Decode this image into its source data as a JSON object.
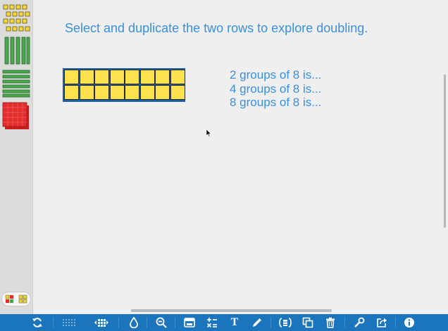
{
  "canvas": {
    "instruction": "Select and duplicate the two rows to explore doubling.",
    "prompts": [
      "2 groups of 8 is...",
      "4 groups of 8 is...",
      "8 groups of 8 is..."
    ],
    "blocks": {
      "rows": 2,
      "columns": 8,
      "fill_color": "#fde24d",
      "frame_color": "#1c5fa8"
    }
  },
  "sidebar": {
    "tools": [
      "units-tool",
      "tens-rods-tool",
      "hundreds-flats-tool",
      "thousands-cubes-tool"
    ]
  },
  "toolbar": {
    "text_tool_glyph": "T",
    "accent_color": "#1b75bc"
  },
  "colors": {
    "instruction_text": "#3a8fde",
    "block_yellow": "#fde24d",
    "rod_green": "#49a84b",
    "flat_red": "#e32c2c"
  }
}
